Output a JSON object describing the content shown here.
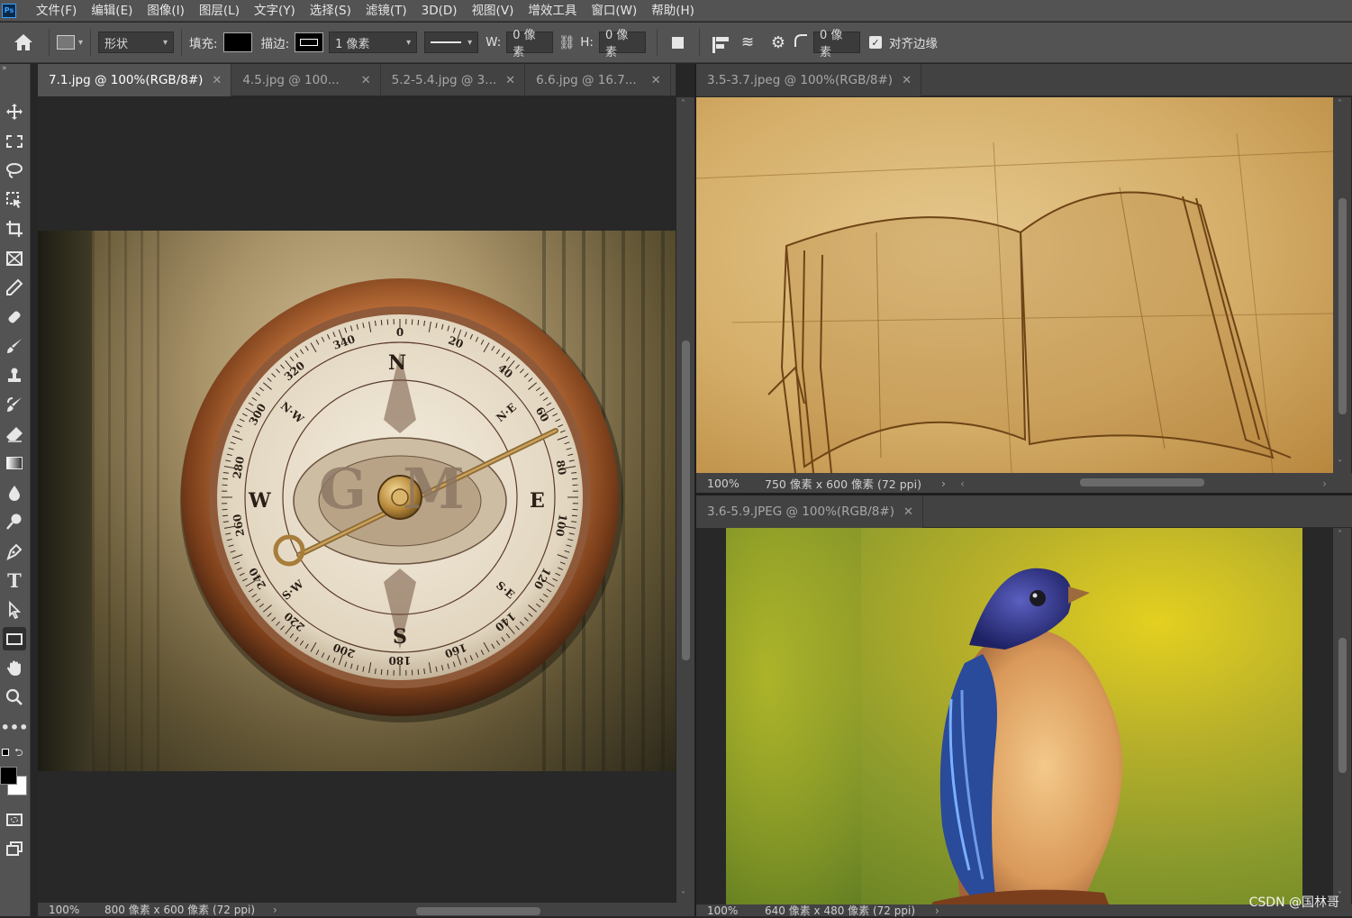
{
  "app_logo": "Ps",
  "menu": [
    "文件(F)",
    "编辑(E)",
    "图像(I)",
    "图层(L)",
    "文字(Y)",
    "选择(S)",
    "滤镜(T)",
    "3D(D)",
    "视图(V)",
    "增效工具",
    "窗口(W)",
    "帮助(H)"
  ],
  "options": {
    "mode": "形状",
    "fill_label": "填充:",
    "stroke_label": "描边:",
    "stroke_width": "1 像素",
    "w_label": "W:",
    "w_value": "0 像素",
    "h_label": "H:",
    "h_value": "0 像素",
    "radius_value": "0 像素",
    "align_edges_label": "对齐边缘",
    "align_edges_checked": true
  },
  "tools": [
    "move-tool",
    "marquee-tool",
    "lasso-tool",
    "object-select-tool",
    "crop-tool",
    "frame-tool",
    "eyedropper-tool",
    "healing-brush-tool",
    "brush-tool",
    "clone-stamp-tool",
    "history-brush-tool",
    "eraser-tool",
    "gradient-tool",
    "blur-tool",
    "dodge-tool",
    "pen-tool",
    "type-tool",
    "path-select-tool",
    "rectangle-tool",
    "hand-tool",
    "zoom-tool",
    "more-tools"
  ],
  "left_doc": {
    "tabs": [
      {
        "label": "7.1.jpg @ 100%(RGB/8#)",
        "active": true
      },
      {
        "label": "4.5.jpg @ 100...",
        "active": false
      },
      {
        "label": "5.2-5.4.jpg @ 3...",
        "active": false
      },
      {
        "label": "6.6.jpg @ 16.7...",
        "active": false
      }
    ],
    "status": {
      "zoom": "100%",
      "size": "800 像素 x 600 像素 (72 ppi)"
    },
    "compass": {
      "labels": {
        "n": "N",
        "s": "S",
        "e": "E",
        "w": "W",
        "ne": "N·E",
        "nw": "N·W",
        "se": "S·E",
        "sw": "S·W"
      },
      "degrees": [
        "0",
        "20",
        "40",
        "60",
        "80",
        "100",
        "120",
        "140",
        "160",
        "180",
        "200",
        "220",
        "240",
        "260",
        "280",
        "300",
        "320",
        "340"
      ],
      "monogram": "GM"
    }
  },
  "top_right_doc": {
    "tab": "3.5-3.7.jpeg @ 100%(RGB/8#)",
    "status": {
      "zoom": "100%",
      "size": "750 像素 x 600 像素 (72 ppi)"
    }
  },
  "bottom_right_doc": {
    "tab": "3.6-5.9.JPEG @ 100%(RGB/8#)",
    "status": {
      "zoom": "100%",
      "size": "640 像素 x 480 像素 (72 ppi)"
    }
  },
  "watermark": "CSDN @国林哥",
  "colors": {
    "panel": "#535353",
    "canvas_bg": "#262626",
    "tab_bg": "#424242"
  }
}
